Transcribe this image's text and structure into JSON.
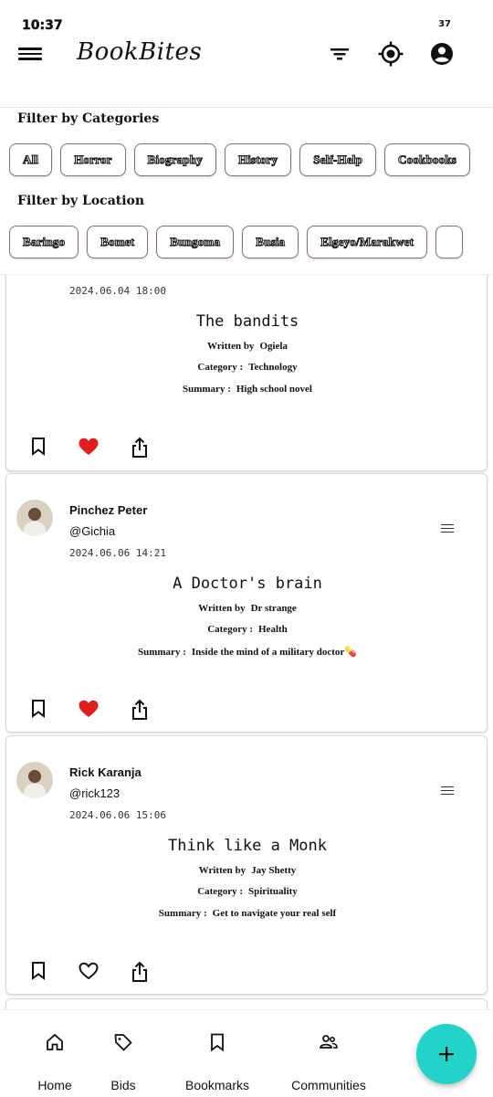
{
  "status": {
    "time": "10:37",
    "battery": "37"
  },
  "appbar": {
    "title": "BookBites"
  },
  "filters": {
    "categories_title": "Filter by Categories",
    "categories": [
      "All",
      "Horror",
      "Biography",
      "History",
      "Self-Help",
      "Cookbooks"
    ],
    "location_title": "Filter by Location",
    "locations": [
      "Baringo",
      "Bomet",
      "Bungoma",
      "Busia",
      "Elgeyo/Marakwet",
      ""
    ]
  },
  "labels": {
    "written_by": "Written by",
    "category": "Category :",
    "summary": "Summary :"
  },
  "posts": [
    {
      "name": "",
      "handle": "",
      "date": "2024.06.04 18:00",
      "title": "The bandits",
      "author": "Ogiela",
      "category": "Technology",
      "summary": "High school novel",
      "liked": true
    },
    {
      "name": "Pinchez Peter",
      "handle": "@Gichia",
      "date": "2024.06.06 14:21",
      "title": "A Doctor's brain",
      "author": "Dr strange",
      "category": "Health",
      "summary": "Inside the mind of a military doctor💊",
      "liked": true
    },
    {
      "name": "Rick Karanja",
      "handle": "@rick123",
      "date": "2024.06.06 15:06",
      "title": "Think like a Monk",
      "author": "Jay Shetty",
      "category": "Spirituality",
      "summary": "Get to navigate your real self",
      "liked": false
    }
  ],
  "nav": {
    "home": "Home",
    "bids": "Bids",
    "bookmarks": "Bookmarks",
    "communities": "Communities"
  },
  "colors": {
    "accent": "#22d3c9",
    "heart": "#e11d1d"
  }
}
